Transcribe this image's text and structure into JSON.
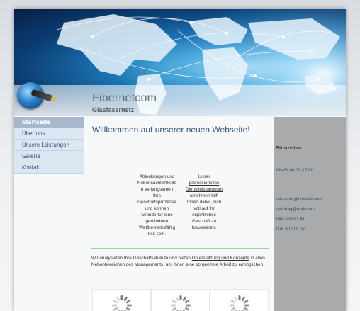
{
  "header": {
    "site_title": "Fibernetcom",
    "site_subtitle": "Glasfasernetz"
  },
  "nav": {
    "items": [
      {
        "label": "Startseite",
        "active": true
      },
      {
        "label": "Über uns",
        "active": false
      },
      {
        "label": "Unsere Leistungen",
        "active": false
      },
      {
        "label": "Galerie",
        "active": false
      },
      {
        "label": "Kontakt",
        "active": false
      }
    ]
  },
  "main": {
    "welcome": "Willkommen auf unserer neuen Webseite!",
    "col1_lines": [
      "Ablenkungen und",
      "Nebensächlichkeite",
      "n verlangsamen",
      "Ihre",
      "Geschäftsprozesse",
      "und können",
      "Gründe für eine",
      "geminderte",
      "Wettbewerbsfähig",
      "keit sein."
    ],
    "col2_lines_pre": [
      "Unser"
    ],
    "col2_link_lines": [
      "professionelles",
      "Dienstleistungsunt",
      "ernehmen"
    ],
    "col2_after_link": " hilft",
    "col2_lines_post": [
      "Ihnen dabei, sich",
      "voll auf Ihr",
      "eigentliches",
      "Geschäft zu",
      "fokussieren."
    ],
    "para_before": "Wir analysieren Ihre Geschäftsabläufe und bieten ",
    "para_link": "Unterstützung und Konzepte",
    "para_after": " in allen Nebenbereichen des Managements, um Ihnen eine sorgenfreie Arbeit zu ermöglichen."
  },
  "sidebar_right": {
    "title": "Bürozeiten",
    "hours": "Mo-Fr  08:00-17:00",
    "email1": "seb-com@hotmail.com",
    "email2": "sebthaq@mail.com",
    "phone1": "044 558 81 41",
    "phone2": "076 307 00 07"
  },
  "colors": {
    "accent": "#2c5480",
    "nav_bg": "#dbe6f3",
    "nav_active": "#a7b7cd",
    "divider": "#9fd49a",
    "sidebar_bg": "#a8aaac"
  }
}
